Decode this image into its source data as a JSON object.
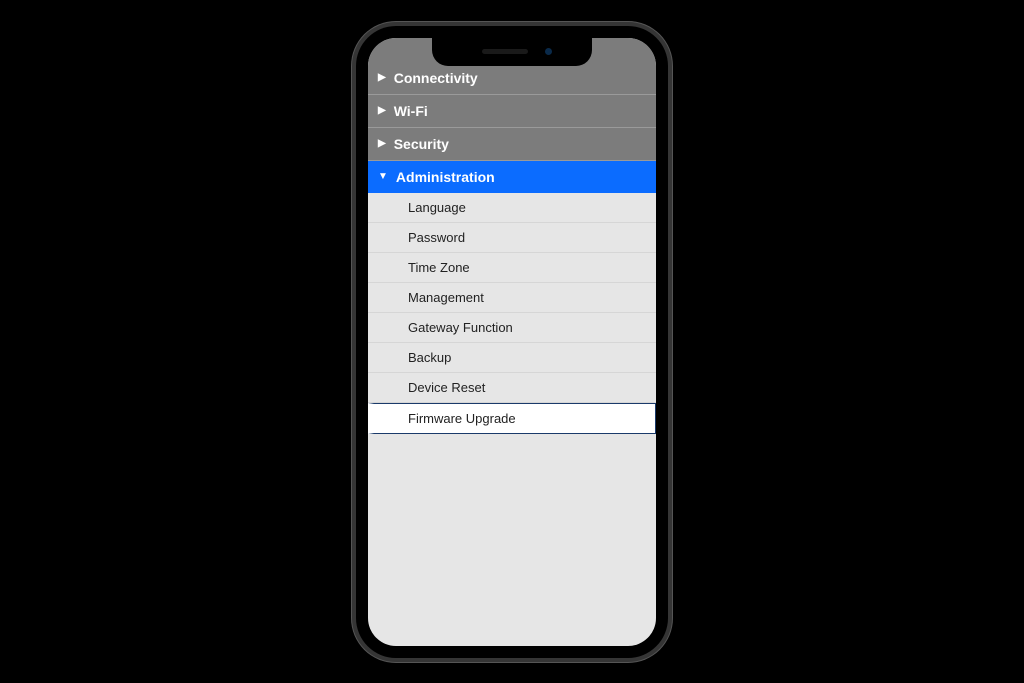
{
  "nav": {
    "sections": [
      {
        "label": "Connectivity",
        "expanded": false
      },
      {
        "label": "Wi-Fi",
        "expanded": false
      },
      {
        "label": "Security",
        "expanded": false
      },
      {
        "label": "Administration",
        "expanded": true,
        "items": [
          {
            "label": "Language",
            "selected": false
          },
          {
            "label": "Password",
            "selected": false
          },
          {
            "label": "Time Zone",
            "selected": false
          },
          {
            "label": "Management",
            "selected": false
          },
          {
            "label": "Gateway Function",
            "selected": false
          },
          {
            "label": "Backup",
            "selected": false
          },
          {
            "label": "Device Reset",
            "selected": false
          },
          {
            "label": "Firmware Upgrade",
            "selected": true
          }
        ]
      }
    ]
  }
}
